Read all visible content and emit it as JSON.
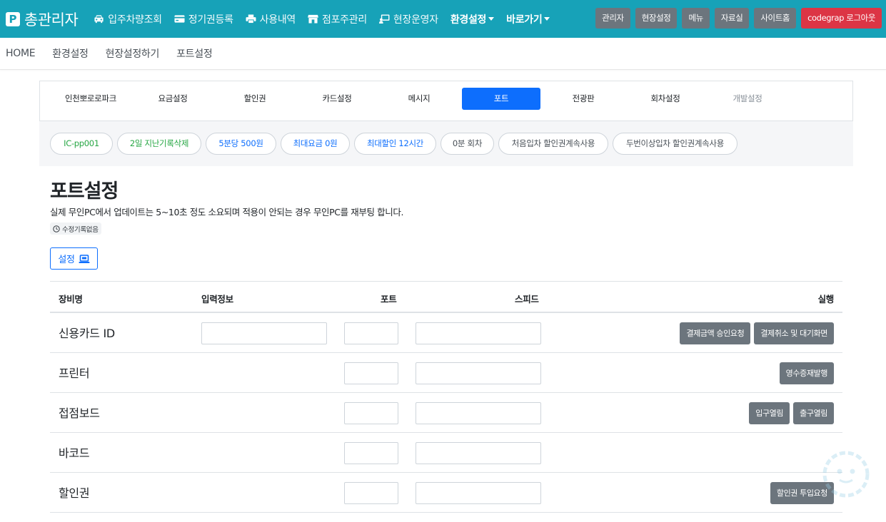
{
  "brand": {
    "logo_letter": "P",
    "title": "총관리자"
  },
  "nav": {
    "items": [
      {
        "label": "입주차량조회",
        "icon": "car-icon"
      },
      {
        "label": "정기권등록",
        "icon": "credit-card-icon"
      },
      {
        "label": "사용내역",
        "icon": "printer-icon"
      },
      {
        "label": "점포주관리",
        "icon": "store-icon"
      },
      {
        "label": "현장운영자",
        "icon": "teacher-icon"
      }
    ],
    "dropdowns": [
      {
        "label": "환경설정"
      },
      {
        "label": "바로가기"
      }
    ],
    "buttons": [
      {
        "label": "관리자"
      },
      {
        "label": "현장설정"
      },
      {
        "label": "메뉴"
      },
      {
        "label": "자료실"
      },
      {
        "label": "사이트홈"
      },
      {
        "label": "codegrap 로그아웃"
      }
    ]
  },
  "subnav": {
    "items": [
      "HOME",
      "환경설정",
      "현장설정하기",
      "포트설정"
    ]
  },
  "tabs": [
    {
      "label": "인천뽀로로파크"
    },
    {
      "label": "요금설정"
    },
    {
      "label": "할인권"
    },
    {
      "label": "카드설정"
    },
    {
      "label": "메시지"
    },
    {
      "label": "포트"
    },
    {
      "label": "전광판"
    },
    {
      "label": "회차설정"
    },
    {
      "label": "개발설정"
    }
  ],
  "pills": [
    {
      "label": "IC-pp001"
    },
    {
      "label": "2일 지난기록삭제"
    },
    {
      "label": "5분당 500원"
    },
    {
      "label": "최대요금 0원"
    },
    {
      "label": "최대할인 12시간"
    },
    {
      "label": "0분 회차"
    },
    {
      "label": "처음입차 할인권계속사용"
    },
    {
      "label": "두번이상입차 할인권계속사용"
    }
  ],
  "page": {
    "title": "포트설정",
    "description": "실제 무인PC에서 업데이트는 5~10초 정도 소요되며 적용이 안되는 경우 무인PC를 재부팅 합니다.",
    "history_label": "수정기록없음",
    "setting_button": "설정"
  },
  "table": {
    "headers": {
      "name": "장비명",
      "info": "입력정보",
      "port": "포트",
      "speed": "스피드",
      "action": "실행"
    },
    "rows": [
      {
        "name": "신용카드 ID",
        "has_info": true,
        "actions": [
          "결제금액 승인요청",
          "결제취소 및 대기화면"
        ]
      },
      {
        "name": "프린터",
        "has_info": false,
        "actions": [
          "영수증재발행"
        ]
      },
      {
        "name": "접점보드",
        "has_info": false,
        "actions": [
          "입구열림",
          "출구열림"
        ]
      },
      {
        "name": "바코드",
        "has_info": false,
        "actions": []
      },
      {
        "name": "할인권",
        "has_info": false,
        "actions": [
          "할인권 투입요청"
        ]
      }
    ]
  },
  "colors": {
    "navbar": "#17a2b8",
    "primary": "#0d6efd",
    "secondary": "#6c757d",
    "danger": "#dc3545",
    "success": "#28a745"
  }
}
